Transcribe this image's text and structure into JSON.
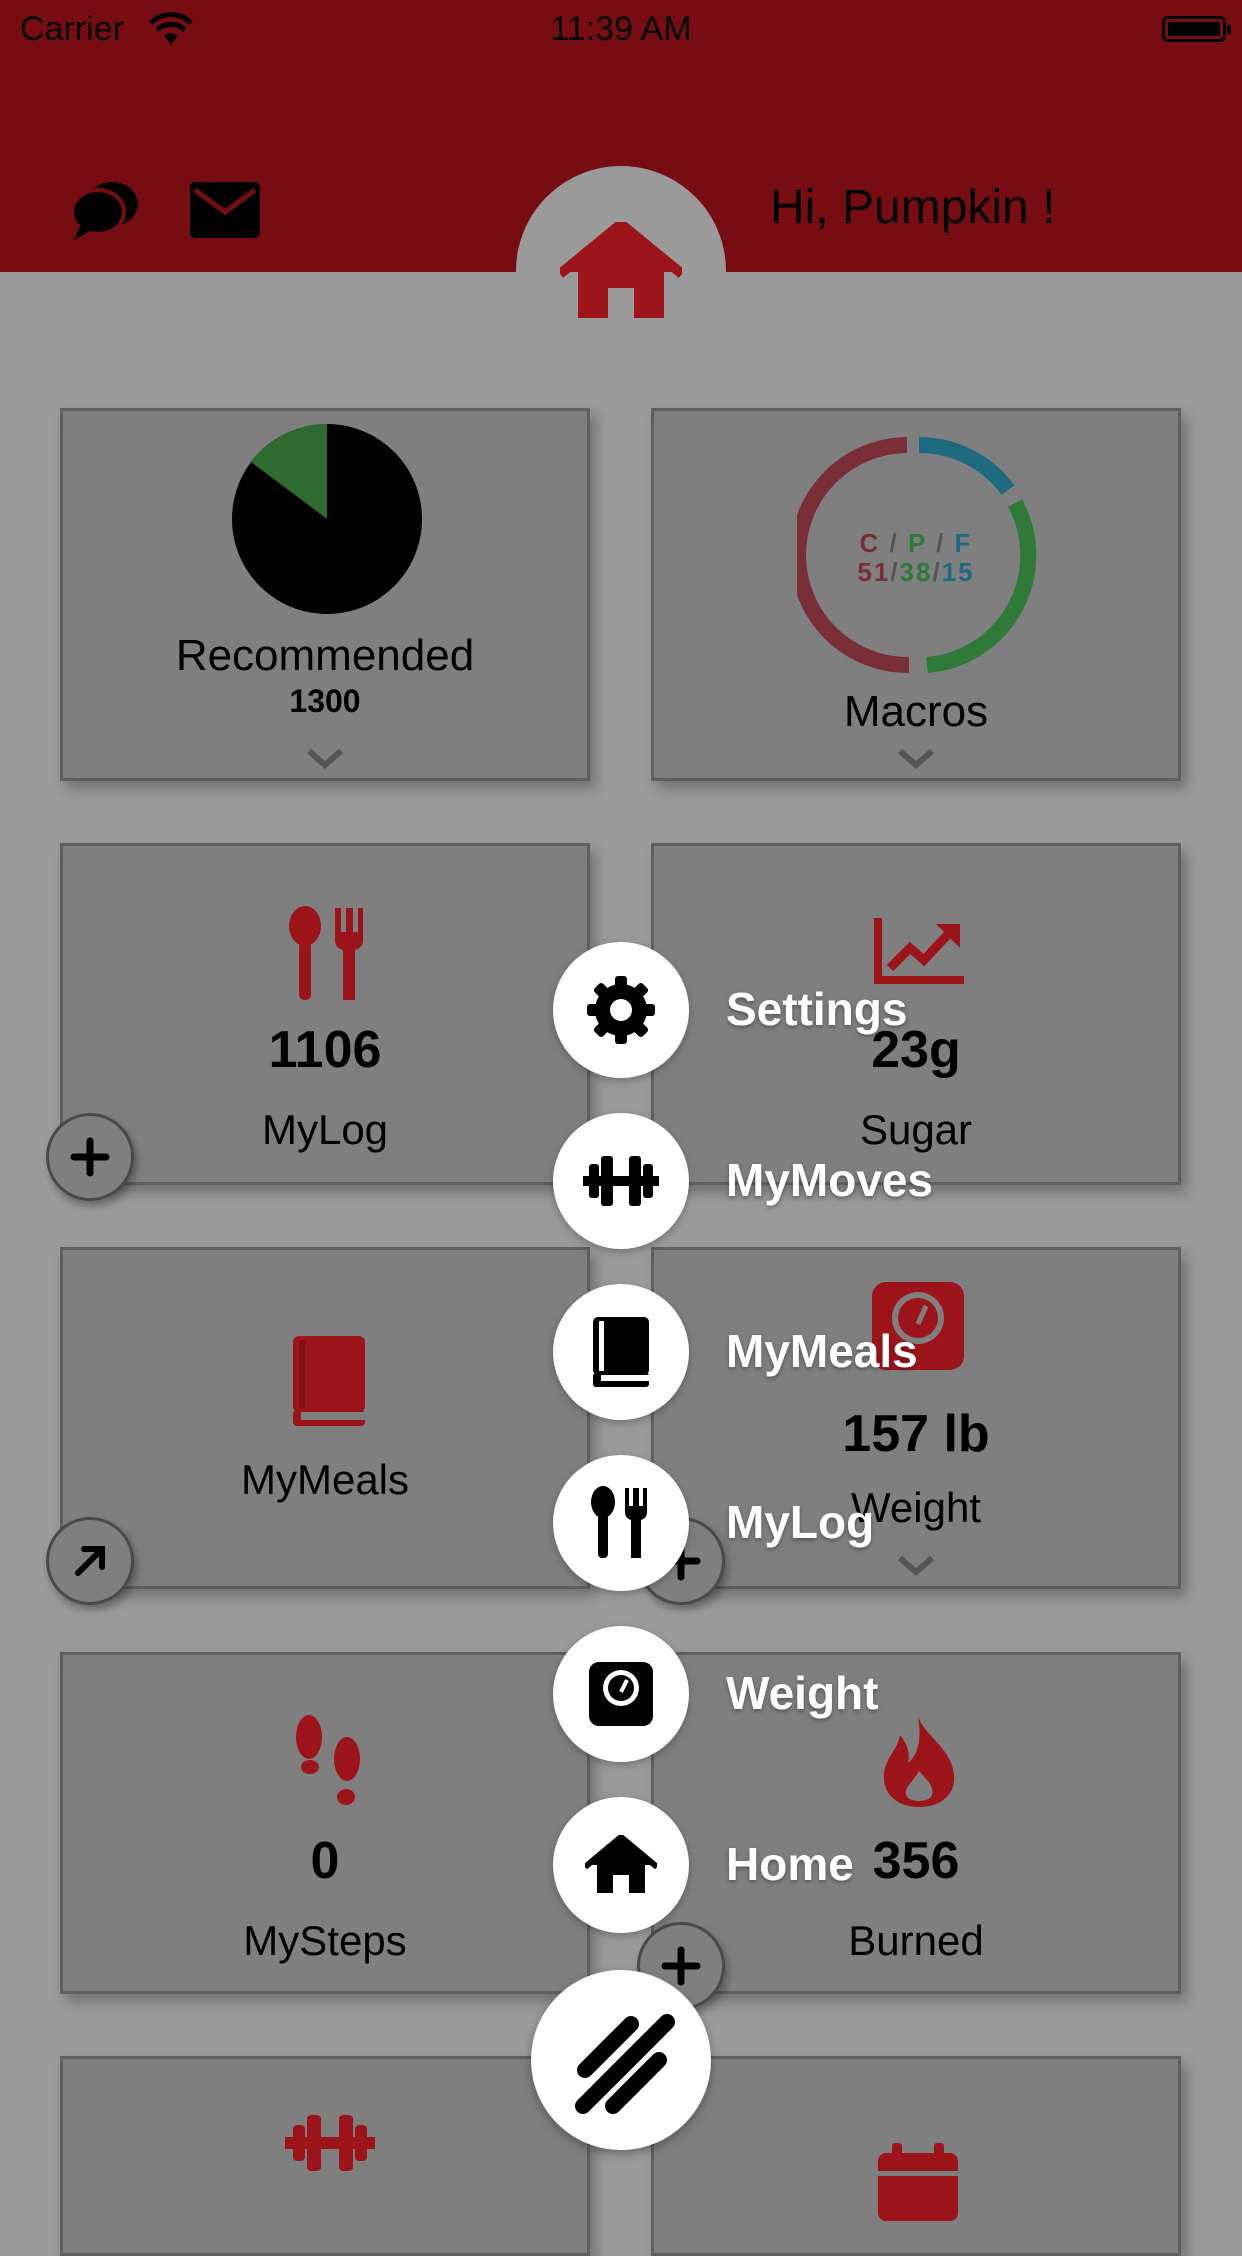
{
  "status": {
    "carrier": "Carrier",
    "time": "11:39 AM"
  },
  "header": {
    "greeting": "Hi, Pumpkin !"
  },
  "cards": {
    "recommended": {
      "label": "Recommended",
      "value": "1300",
      "pie_fraction": 0.25
    },
    "macros": {
      "label": "Macros",
      "header": "C / P / F",
      "values": "51/38/15",
      "segments": {
        "carbs": 51,
        "protein": 38,
        "fat": 15
      }
    },
    "mylog": {
      "value": "1106",
      "label": "MyLog"
    },
    "sugar": {
      "value": "23g",
      "label": "Sugar"
    },
    "mymeals": {
      "label": "MyMeals"
    },
    "weight": {
      "value": "157 lb",
      "label": "Weight"
    },
    "mysteps": {
      "value": "0",
      "label": "MySteps"
    },
    "burned": {
      "value": "356",
      "label": "Burned"
    }
  },
  "fab_menu": {
    "items": [
      {
        "label": "Settings",
        "icon": "gear-icon"
      },
      {
        "label": "MyMoves",
        "icon": "dumbbell-icon"
      },
      {
        "label": "MyMeals",
        "icon": "book-icon"
      },
      {
        "label": "MyLog",
        "icon": "utensils-icon"
      },
      {
        "label": "Weight",
        "icon": "scale-icon"
      },
      {
        "label": "Home",
        "icon": "home-icon"
      }
    ]
  },
  "colors": {
    "brand_red": "#770d12",
    "icon_red": "#9e141b",
    "carbs": "#7a2f38",
    "protein": "#2f7a38",
    "fat": "#1e6a80"
  }
}
